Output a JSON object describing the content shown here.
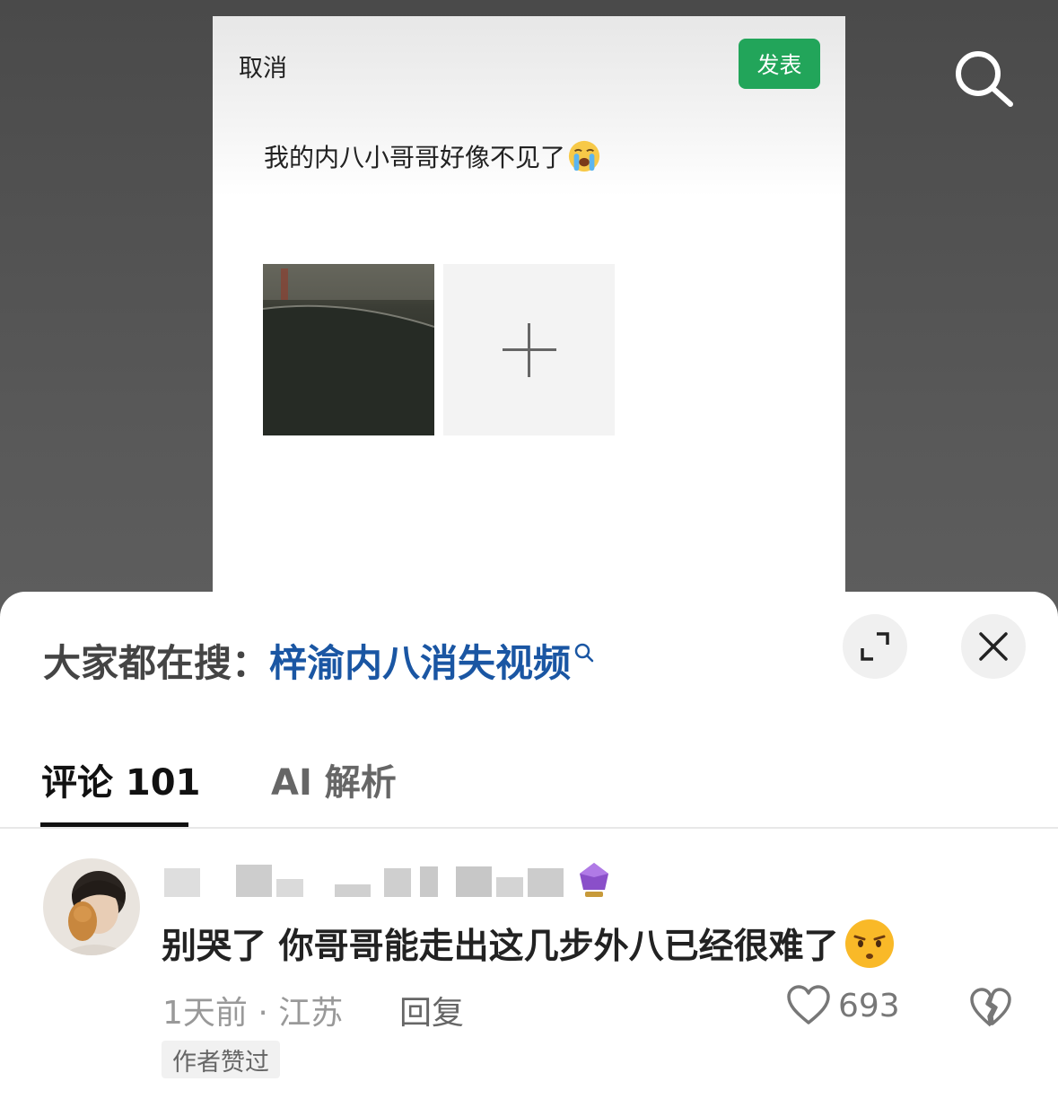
{
  "editor": {
    "cancel_label": "取消",
    "publish_label": "发表",
    "post_text": "我的内八小哥哥好像不见了",
    "post_emoji": "crying-face-emoji",
    "add_image_icon": "plus-icon"
  },
  "top_bar": {
    "search_icon": "search-icon"
  },
  "sheet": {
    "suggest_prefix": "大家都在搜：",
    "suggest_query": "梓渝内八消失视频",
    "expand_icon": "expand-icon",
    "close_icon": "close-icon",
    "tabs": [
      {
        "label": "评论 101",
        "active": true
      },
      {
        "label": "AI 解析",
        "active": false
      }
    ]
  },
  "comment": {
    "text": "别哭了 你哥哥能走出这几步外八已经很难了",
    "emoji": "smirking-face-emoji",
    "meta": "1天前 · 江苏",
    "reply_label": "回复",
    "like_count": "693",
    "author_liked_label": "作者赞过"
  },
  "colors": {
    "publish_green": "#22a55a",
    "link_blue": "#1a56a3"
  }
}
